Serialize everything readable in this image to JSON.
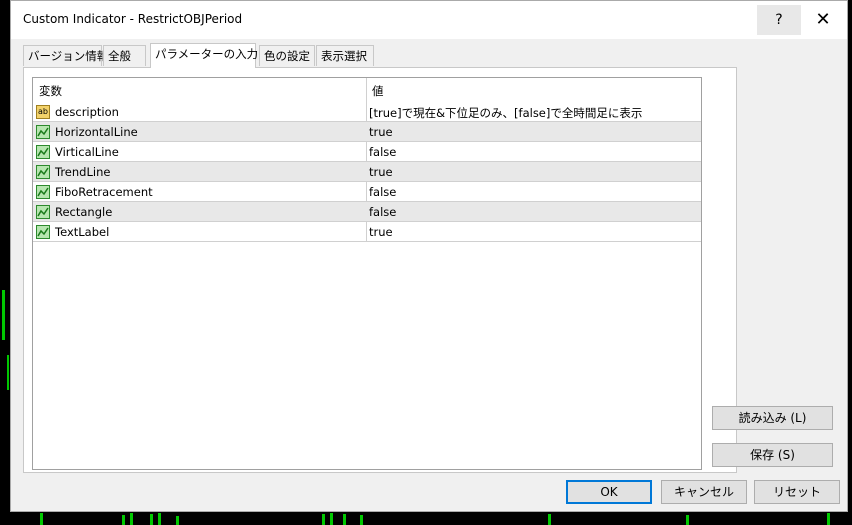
{
  "window": {
    "title": "Custom Indicator - RestrictOBJPeriod",
    "help_label": "?",
    "close_label": "✕"
  },
  "tabs": [
    {
      "label": "バージョン情報"
    },
    {
      "label": "全般"
    },
    {
      "label": "パラメーターの入力"
    },
    {
      "label": "色の設定"
    },
    {
      "label": "表示選択"
    }
  ],
  "active_tab": "パラメーターの入力",
  "table": {
    "headers": {
      "variable": "変数",
      "value": "値"
    },
    "rows": [
      {
        "icon": "ab-icon",
        "name": "description",
        "value": "[true]で現在&下位足のみ、[false]で全時間足に表示"
      },
      {
        "icon": "line-chart-icon",
        "name": "HorizontalLine",
        "value": "true"
      },
      {
        "icon": "line-chart-icon",
        "name": "VirticalLine",
        "value": "false"
      },
      {
        "icon": "line-chart-icon",
        "name": "TrendLine",
        "value": "true"
      },
      {
        "icon": "line-chart-icon",
        "name": "FiboRetracement",
        "value": "false"
      },
      {
        "icon": "line-chart-icon",
        "name": "Rectangle",
        "value": "false"
      },
      {
        "icon": "line-chart-icon",
        "name": "TextLabel",
        "value": "true"
      }
    ]
  },
  "buttons": {
    "load": "読み込み (L)",
    "save": "保存 (S)",
    "ok": "OK",
    "cancel": "キャンセル",
    "reset": "リセット"
  },
  "colors": {
    "background": "#000000",
    "chart_green": "#00c800",
    "focus_blue": "#0078d7"
  }
}
